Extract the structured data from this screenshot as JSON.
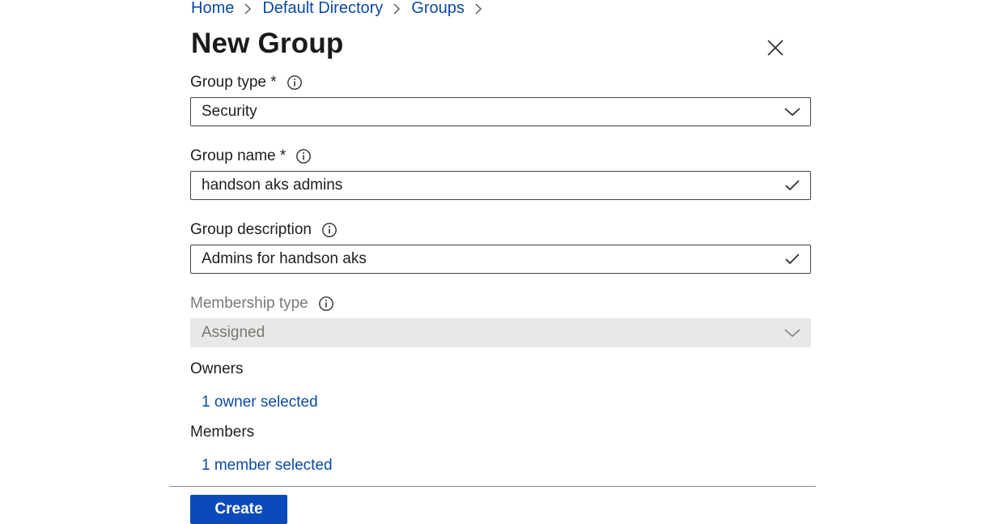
{
  "breadcrumb": {
    "items": [
      "Home",
      "Default Directory",
      "Groups"
    ]
  },
  "page": {
    "title": "New Group",
    "close_icon": "close-icon"
  },
  "form": {
    "group_type": {
      "label": "Group type *",
      "value": "Security",
      "icon": "chevron-down-icon"
    },
    "group_name": {
      "label": "Group name *",
      "value": "handson aks admins",
      "icon": "checkmark-icon"
    },
    "group_description": {
      "label": "Group description",
      "value": "Admins for handson aks",
      "icon": "checkmark-icon"
    },
    "membership_type": {
      "label": "Membership type",
      "value": "Assigned",
      "disabled": true,
      "icon": "chevron-down-icon"
    },
    "owners": {
      "label": "Owners",
      "link": "1 owner selected"
    },
    "members": {
      "label": "Members",
      "link": "1 member selected"
    }
  },
  "footer": {
    "create_label": "Create"
  },
  "colors": {
    "link": "#0b4aa2",
    "primary_button": "#0b4aba",
    "field_border": "#4a3a50",
    "disabled_bg": "#e9e8e7"
  }
}
